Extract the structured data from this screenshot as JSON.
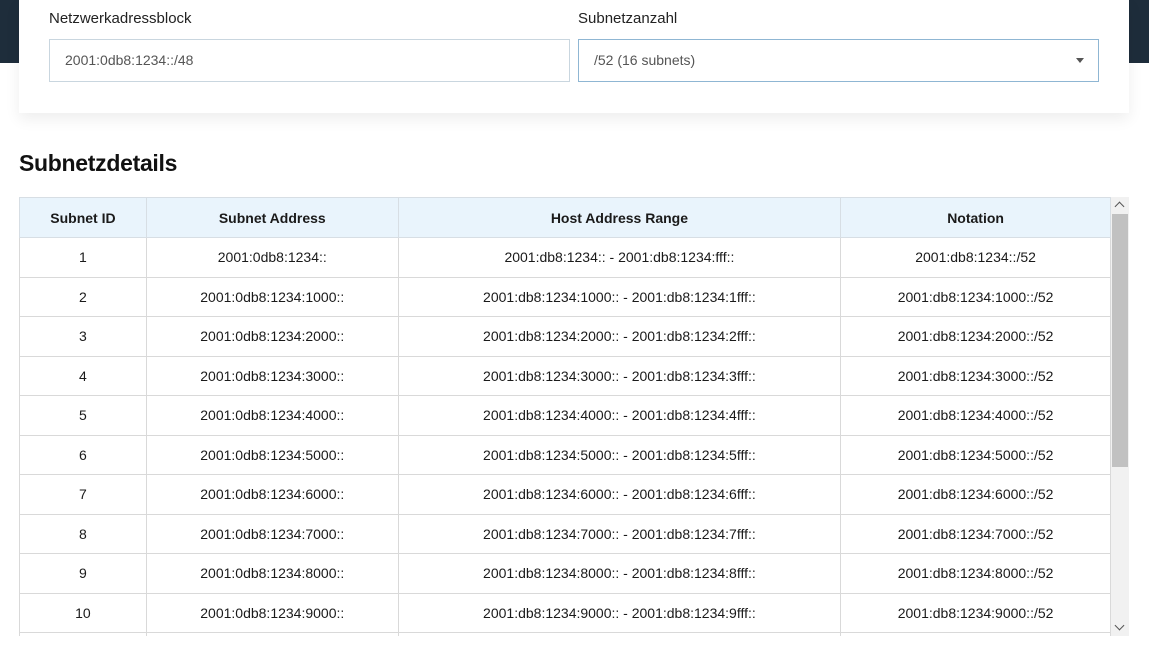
{
  "form": {
    "network_label": "Netzwerkadressblock",
    "network_value": "2001:0db8:1234::/48",
    "count_label": "Subnetzanzahl",
    "count_value": "/52 (16 subnets)"
  },
  "section_title": "Subnetzdetails",
  "table": {
    "headers": [
      "Subnet ID",
      "Subnet Address",
      "Host Address Range",
      "Notation"
    ],
    "rows": [
      [
        "1",
        "2001:0db8:1234::",
        "2001:db8:1234:: - 2001:db8:1234:fff::",
        "2001:db8:1234::/52"
      ],
      [
        "2",
        "2001:0db8:1234:1000::",
        "2001:db8:1234:1000:: - 2001:db8:1234:1fff::",
        "2001:db8:1234:1000::/52"
      ],
      [
        "3",
        "2001:0db8:1234:2000::",
        "2001:db8:1234:2000:: - 2001:db8:1234:2fff::",
        "2001:db8:1234:2000::/52"
      ],
      [
        "4",
        "2001:0db8:1234:3000::",
        "2001:db8:1234:3000:: - 2001:db8:1234:3fff::",
        "2001:db8:1234:3000::/52"
      ],
      [
        "5",
        "2001:0db8:1234:4000::",
        "2001:db8:1234:4000:: - 2001:db8:1234:4fff::",
        "2001:db8:1234:4000::/52"
      ],
      [
        "6",
        "2001:0db8:1234:5000::",
        "2001:db8:1234:5000:: - 2001:db8:1234:5fff::",
        "2001:db8:1234:5000::/52"
      ],
      [
        "7",
        "2001:0db8:1234:6000::",
        "2001:db8:1234:6000:: - 2001:db8:1234:6fff::",
        "2001:db8:1234:6000::/52"
      ],
      [
        "8",
        "2001:0db8:1234:7000::",
        "2001:db8:1234:7000:: - 2001:db8:1234:7fff::",
        "2001:db8:1234:7000::/52"
      ],
      [
        "9",
        "2001:0db8:1234:8000::",
        "2001:db8:1234:8000:: - 2001:db8:1234:8fff::",
        "2001:db8:1234:8000::/52"
      ],
      [
        "10",
        "2001:0db8:1234:9000::",
        "2001:db8:1234:9000:: - 2001:db8:1234:9fff::",
        "2001:db8:1234:9000::/52"
      ],
      [
        "",
        "",
        "",
        ""
      ]
    ]
  }
}
